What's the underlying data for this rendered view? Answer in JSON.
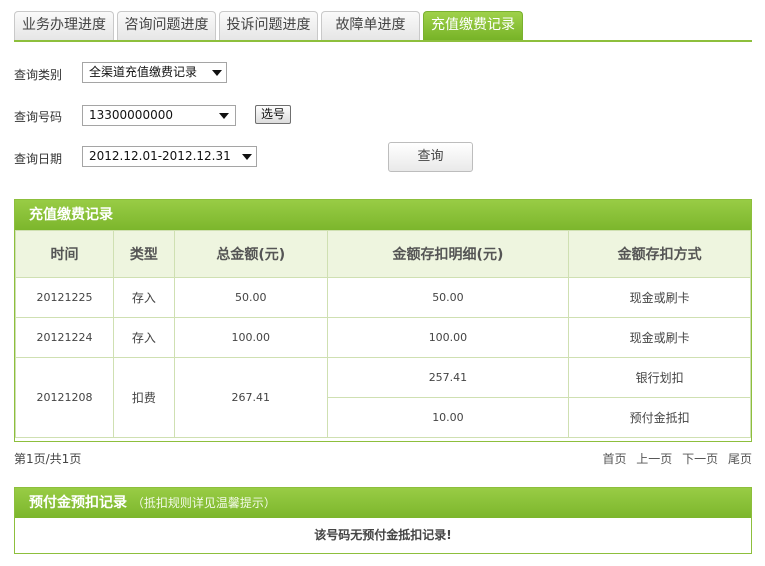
{
  "tabs": [
    {
      "label": "业务办理进度"
    },
    {
      "label": "咨询问题进度"
    },
    {
      "label": "投诉问题进度"
    },
    {
      "label": "故障单进度"
    },
    {
      "label": "充值缴费记录"
    }
  ],
  "form": {
    "category_label": "查询类别",
    "category_value": "全渠道充值缴费记录",
    "number_label": "查询号码",
    "number_value": "13300000000",
    "pick_button": "选号",
    "date_label": "查询日期",
    "date_value": "2012.12.01-2012.12.31",
    "query_button": "查询"
  },
  "records": {
    "title": "充值缴费记录",
    "headers": [
      "时间",
      "类型",
      "总金额(元)",
      "金额存扣明细(元)",
      "金额存扣方式"
    ],
    "rows": [
      {
        "time": "20121225",
        "type": "存入",
        "total": "50.00",
        "detail": "50.00",
        "method": "现金或刷卡"
      },
      {
        "time": "20121224",
        "type": "存入",
        "total": "100.00",
        "detail": "100.00",
        "method": "现金或刷卡"
      },
      {
        "time": "20121208",
        "type": "扣费",
        "total": "267.41",
        "details": [
          {
            "detail": "257.41",
            "method": "银行划扣"
          },
          {
            "detail": "10.00",
            "method": "预付金抵扣"
          }
        ]
      }
    ]
  },
  "pagination": {
    "info": "第1页/共1页",
    "first": "首页",
    "prev": "上一页",
    "next": "下一页",
    "last": "尾页"
  },
  "prepaid": {
    "title": "预付金预扣记录",
    "note": "（抵扣规则详见温馨提示）",
    "empty_message": "该号码无预付金抵扣记录!"
  }
}
